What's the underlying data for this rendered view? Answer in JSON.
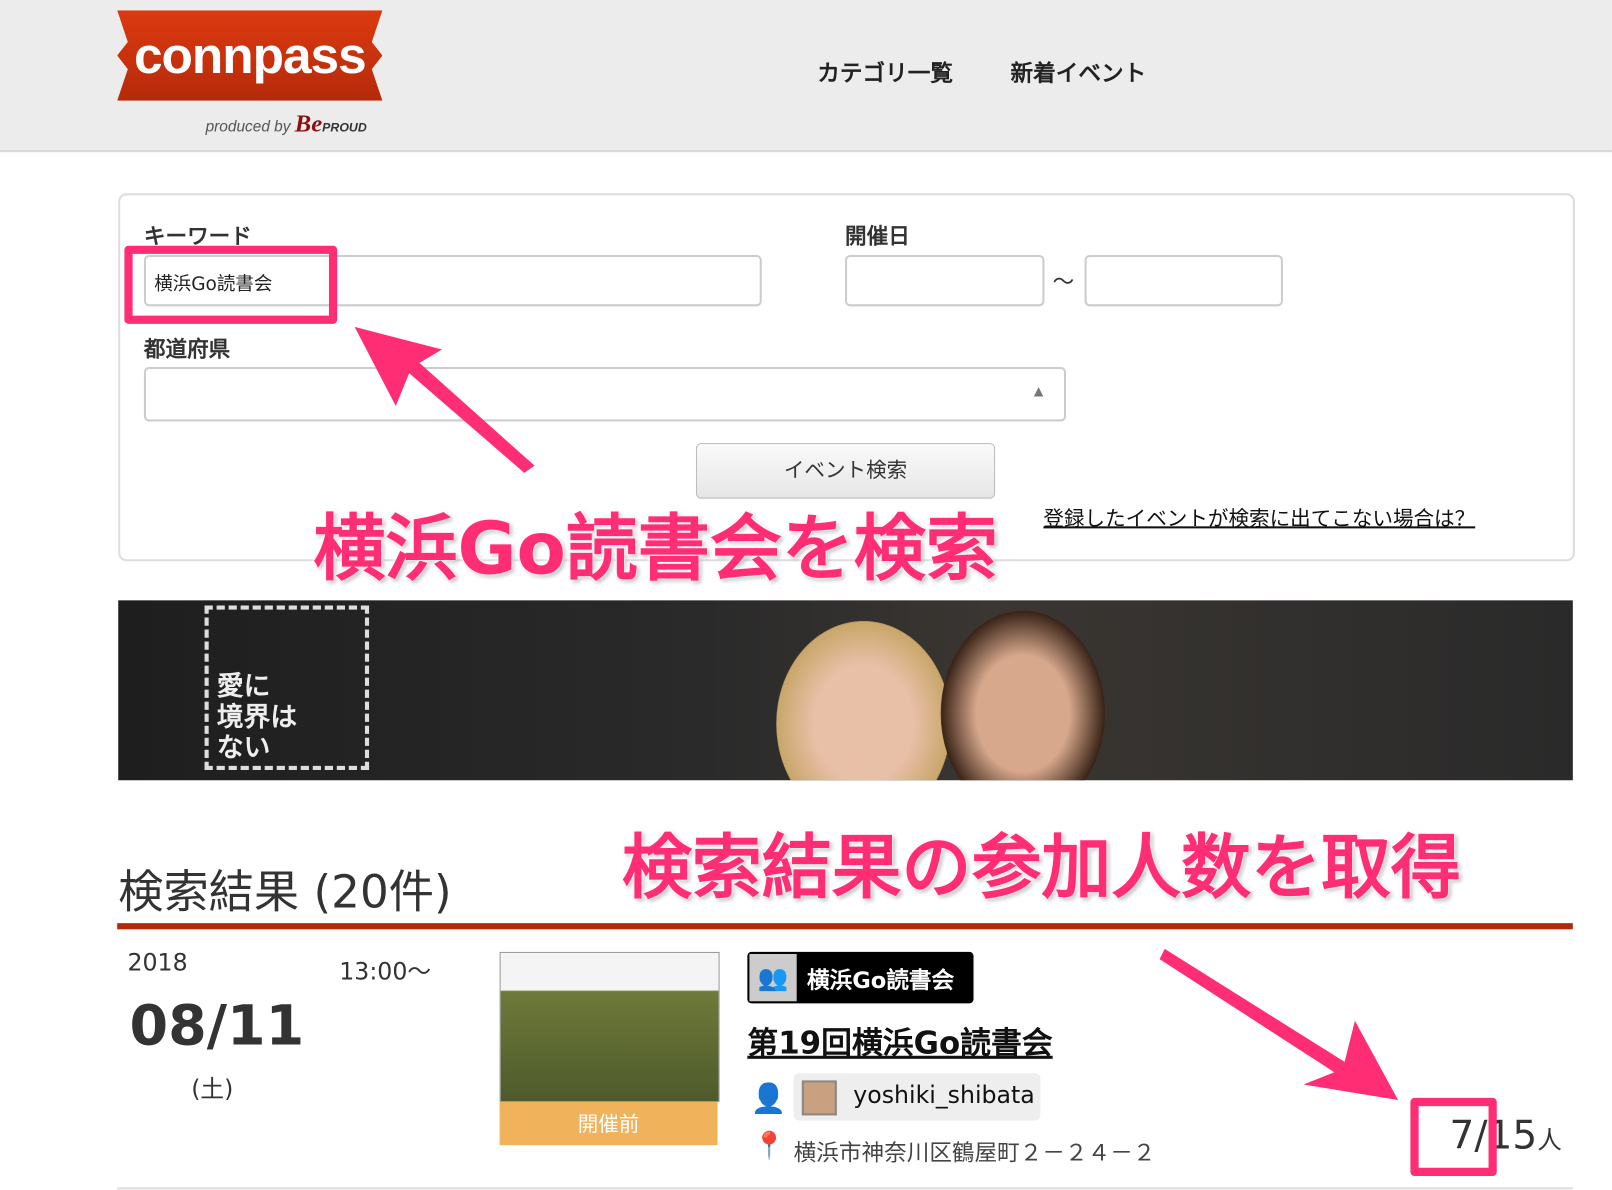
{
  "header": {
    "logo_text": "connpass",
    "produced_by": "produced by",
    "produced_brand": "Be",
    "produced_brand2": "PROUD",
    "nav": [
      "カテゴリ一覧",
      "新着イベント"
    ]
  },
  "search": {
    "keyword_label": "キーワード",
    "keyword_value": "横浜Go読書会",
    "date_label": "開催日",
    "date_sep": "〜",
    "pref_label": "都道府県",
    "search_button": "イベント検索",
    "help_link": "登録したイベントが検索に出てこない場合は？"
  },
  "banner": {
    "text": [
      "愛に",
      "境界は",
      "ない"
    ]
  },
  "annotations": {
    "search": "横浜Go読書会を検索",
    "count": "検索結果の参加人数を取得",
    "accent": "#ff2d74"
  },
  "results": {
    "title": "検索結果 (20件)",
    "items": [
      {
        "year": "2018",
        "time": "13:00〜",
        "date": "08/11",
        "weekday": "(土)",
        "status": "開催前",
        "group": "横浜Go読書会",
        "title": "第19回横浜Go読書会",
        "owner": "yoshiki_shibata",
        "address": "横浜市神奈川区鶴屋町２－２４－２",
        "joined": "7",
        "capacity": "/15",
        "unit": "人"
      }
    ]
  }
}
